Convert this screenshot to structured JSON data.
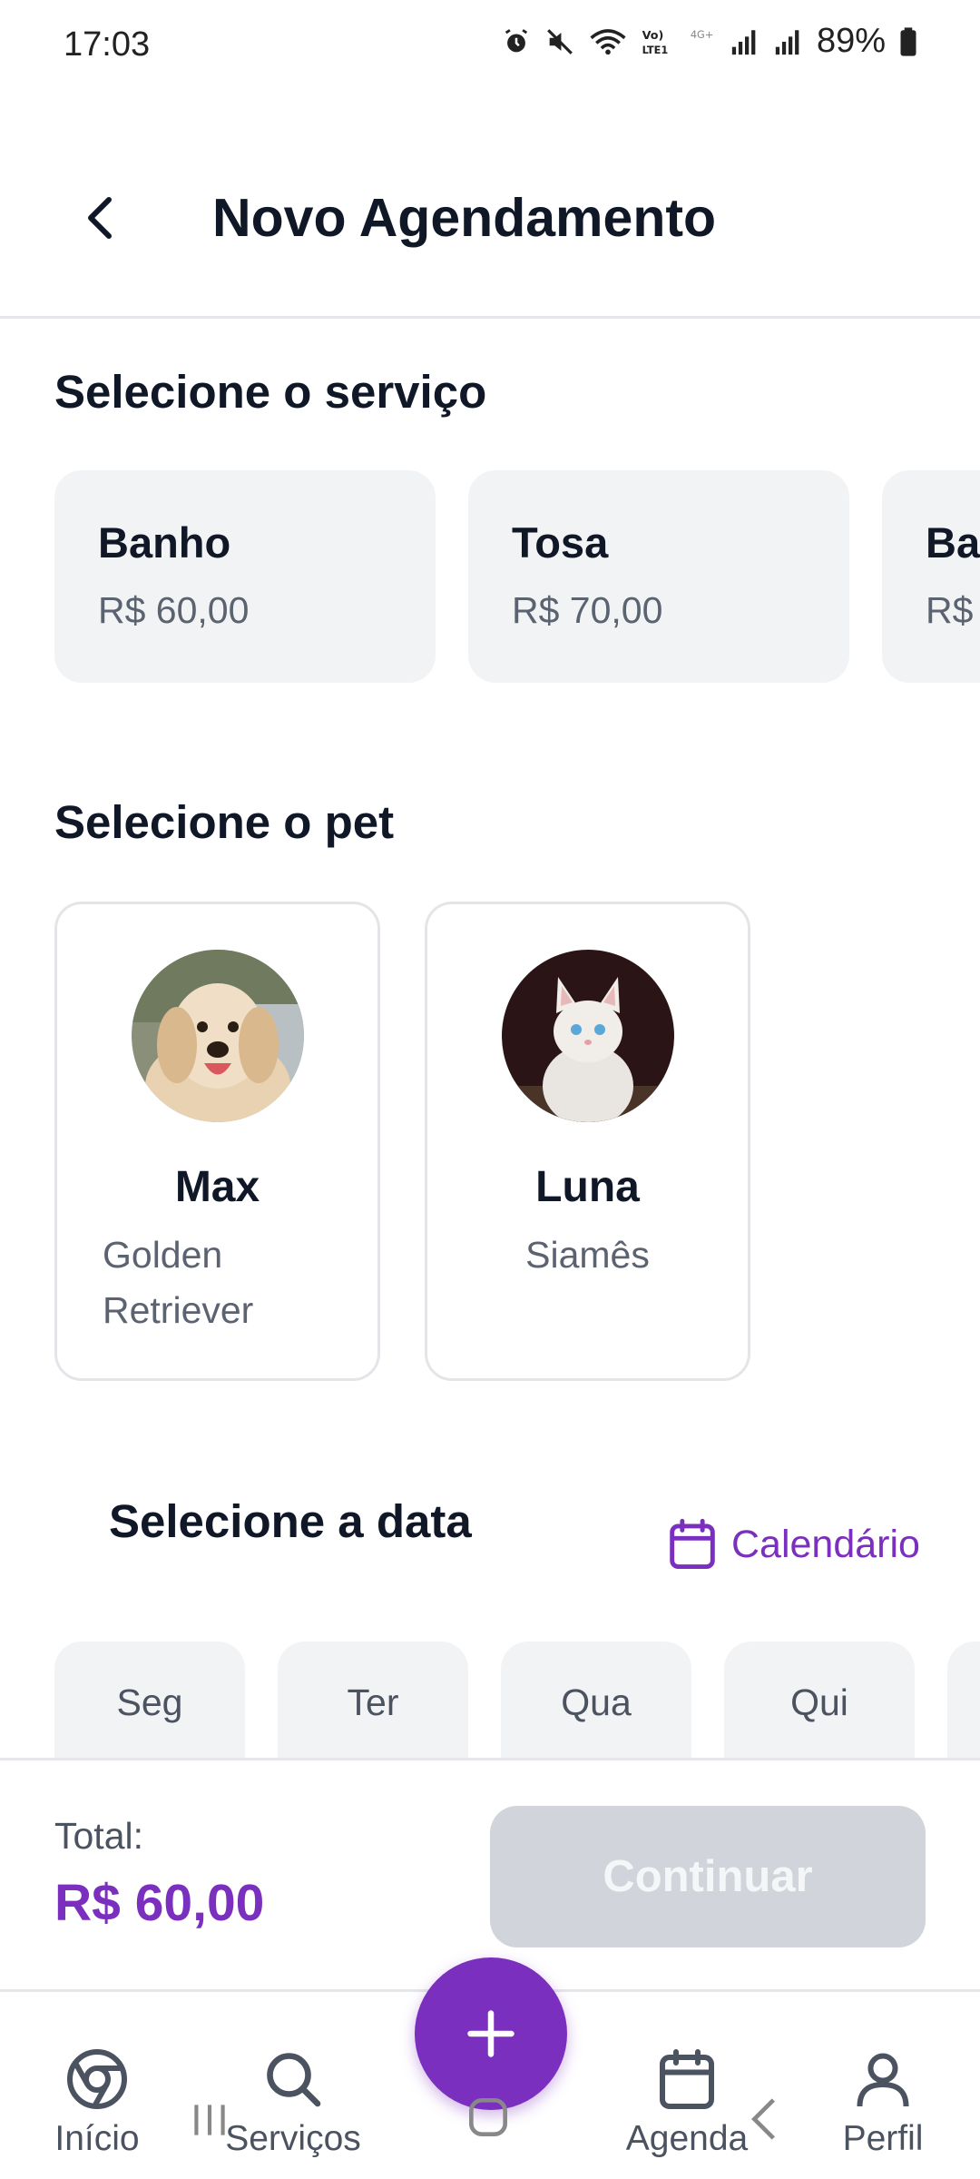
{
  "status_bar": {
    "time": "17:03",
    "battery": "89%"
  },
  "header": {
    "title": "Novo Agendamento"
  },
  "services": {
    "title": "Selecione o serviço",
    "items": [
      {
        "name": "Banho",
        "price": "R$ 60,00"
      },
      {
        "name": "Tosa",
        "price": "R$ 70,00"
      },
      {
        "name": "Ba",
        "price": "R$"
      }
    ]
  },
  "pets": {
    "title": "Selecione o pet",
    "items": [
      {
        "name": "Max",
        "breed": "Golden Retriever"
      },
      {
        "name": "Luna",
        "breed": "Siamês"
      }
    ]
  },
  "date": {
    "title": "Selecione a data",
    "calendar_label": "Calendário",
    "days": [
      "Seg",
      "Ter",
      "Qua",
      "Qui"
    ]
  },
  "footer": {
    "total_label": "Total:",
    "total_value": "R$ 60,00",
    "continue_label": "Continuar"
  },
  "nav": {
    "items": [
      {
        "label": "Início",
        "icon": "chrome-icon"
      },
      {
        "label": "Serviços",
        "icon": "search-icon"
      },
      {
        "label": "Agenda",
        "icon": "calendar-icon"
      },
      {
        "label": "Perfil",
        "icon": "user-icon"
      }
    ],
    "fab_icon": "plus-icon"
  },
  "colors": {
    "accent": "#7b2fbe",
    "card_bg": "#f2f3f5",
    "disabled_button": "#d1d5db"
  }
}
